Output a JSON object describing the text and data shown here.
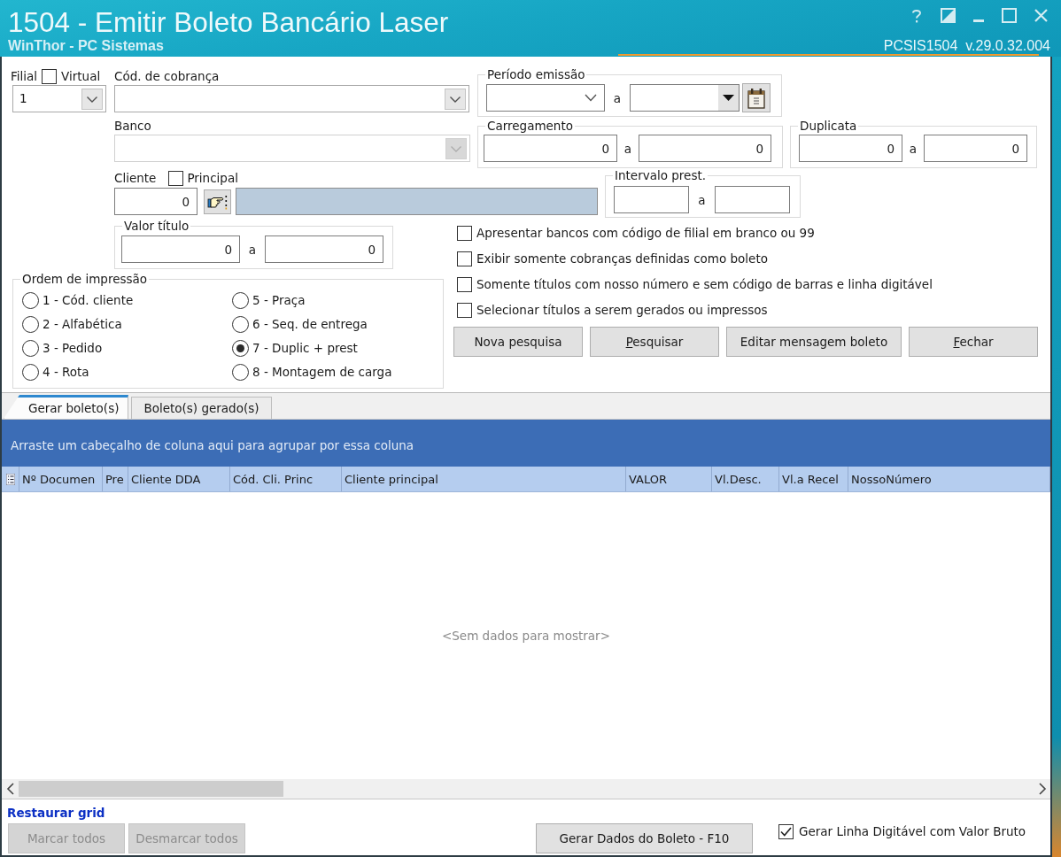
{
  "window": {
    "title": "1504 - Emitir Boleto Bancário Laser",
    "subtitle": "WinThor - PC Sistemas",
    "version": "PCSIS1504  v.29.0.32.004"
  },
  "filial": {
    "label": "Filial",
    "value": "1",
    "virtual": {
      "label": "Virtual",
      "checked": false
    }
  },
  "cod_cobranca": {
    "label": "Cód. de cobrança",
    "disabled": false
  },
  "periodo_emissao": {
    "label": "Período emissão",
    "separator": "a"
  },
  "banco": {
    "label": "Banco",
    "disabled": true
  },
  "carregamento": {
    "label": "Carregamento",
    "from": "0",
    "separator": "a",
    "to": "0"
  },
  "duplicata": {
    "label": "Duplicata",
    "from": "0",
    "separator": "a",
    "to": "0"
  },
  "cliente": {
    "label": "Cliente",
    "value": "0",
    "principal": {
      "label": "Principal",
      "checked": false
    },
    "name_field": {
      "disabled": true
    }
  },
  "intervalo_prest": {
    "label": "Intervalo prest.",
    "separator": "a"
  },
  "valor_titulo": {
    "label": "Valor título",
    "from": "0",
    "separator": "a",
    "to": "0"
  },
  "ordem_impressao": {
    "label": "Ordem de impressão",
    "options": [
      {
        "label": "1 - Cód. cliente",
        "selected": false
      },
      {
        "label": "2 - Alfabética",
        "selected": false
      },
      {
        "label": "3 - Pedido",
        "selected": false
      },
      {
        "label": "4 - Rota",
        "selected": false
      },
      {
        "label": "5 - Praça",
        "selected": false
      },
      {
        "label": "6 - Seq. de entrega",
        "selected": false
      },
      {
        "label": "7 - Duplic + prest",
        "selected": true
      },
      {
        "label": "8 - Montagem de carga",
        "selected": false
      }
    ]
  },
  "options": [
    {
      "label": "Apresentar bancos com código de filial em branco ou 99",
      "checked": false
    },
    {
      "label": "Exibir somente cobranças definidas como boleto",
      "checked": false
    },
    {
      "label": "Somente títulos com nosso número e sem código de barras e linha digitável",
      "checked": false
    },
    {
      "label": "Selecionar títulos a serem gerados ou impressos",
      "checked": false
    }
  ],
  "buttons": [
    {
      "label": "Nova pesquisa",
      "mnemonic": false
    },
    {
      "label": "Pesquisar",
      "mnemonic": true
    },
    {
      "label": "Editar mensagem boleto",
      "mnemonic": false
    },
    {
      "label": "Fechar",
      "mnemonic": true
    }
  ],
  "tabs": [
    {
      "label": "Gerar boleto(s)",
      "selected": true
    },
    {
      "label": "Boleto(s) gerado(s)",
      "selected": false
    }
  ],
  "grid": {
    "group_hint": "Arraste um cabeçalho de coluna aqui para agrupar por essa coluna",
    "columns": [
      "Nº Documen",
      "Pre",
      "Cliente DDA",
      "Cód. Cli. Princ",
      "Cliente principal",
      "VALOR",
      "Vl.Desc.",
      "Vl.a Recel",
      "NossoNúmero"
    ],
    "empty_text": "<Sem dados para mostrar>"
  },
  "footer": {
    "restore_link": "Restaurar grid",
    "buttons": [
      {
        "label": "Marcar todos",
        "disabled": true
      },
      {
        "label": "Desmarcar todos",
        "disabled": true
      }
    ],
    "generate_button": "Gerar Dados do Boleto - F10",
    "gross_value": {
      "label": "Gerar Linha Digitável com Valor Bruto",
      "checked": true
    }
  }
}
